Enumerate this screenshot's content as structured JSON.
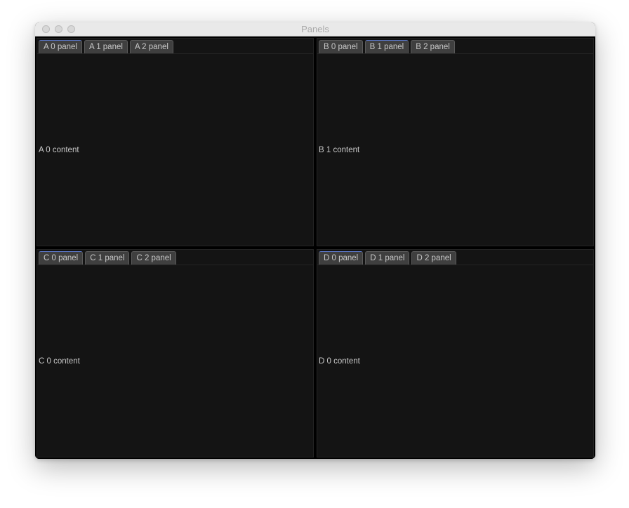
{
  "window": {
    "title": "Panels"
  },
  "panels": {
    "A": {
      "tabs": [
        {
          "label": "A 0 panel",
          "active": true
        },
        {
          "label": "A 1 panel",
          "active": false
        },
        {
          "label": "A 2 panel",
          "active": false
        }
      ],
      "content": "A 0 content"
    },
    "B": {
      "tabs": [
        {
          "label": "B 0 panel",
          "active": false
        },
        {
          "label": "B 1 panel",
          "active": true
        },
        {
          "label": "B 2 panel",
          "active": false
        }
      ],
      "content": "B 1 content"
    },
    "C": {
      "tabs": [
        {
          "label": "C 0 panel",
          "active": true
        },
        {
          "label": "C 1 panel",
          "active": false
        },
        {
          "label": "C 2 panel",
          "active": false
        }
      ],
      "content": "C 0 content"
    },
    "D": {
      "tabs": [
        {
          "label": "D 0 panel",
          "active": true
        },
        {
          "label": "D 1 panel",
          "active": false
        },
        {
          "label": "D 2 panel",
          "active": false
        }
      ],
      "content": "D 0 content"
    }
  }
}
